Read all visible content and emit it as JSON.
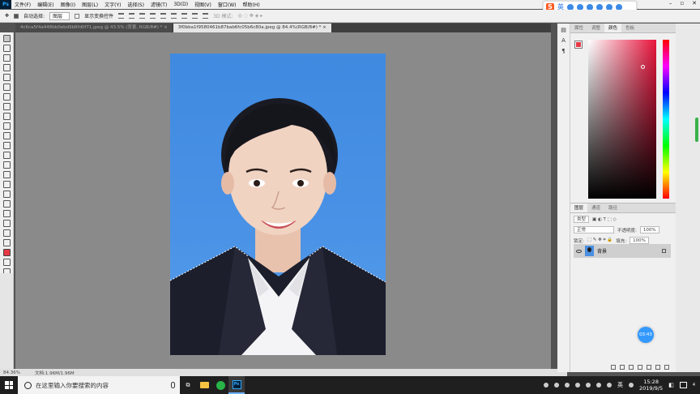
{
  "app": {
    "logo": "Ps"
  },
  "menu": [
    "文件(F)",
    "编辑(E)",
    "图像(I)",
    "图层(L)",
    "文字(Y)",
    "选择(S)",
    "滤镜(T)",
    "3D(D)",
    "视图(V)",
    "窗口(W)",
    "帮助(H)"
  ],
  "options": {
    "auto_select_label": "自动选择:",
    "auto_select_value": "图层",
    "show_transform_label": "显示变换控件",
    "mode_3d": "3D 模式:"
  },
  "ime": {
    "logo": "S",
    "lang": "英"
  },
  "tabs": [
    {
      "label": "4c6ca5f4a448bb0ebd9b8fd0f71.jpeg @ 43.5% (背景, RGB/8#) *",
      "close": "×"
    },
    {
      "label": "3f0bba1f9580461b87bab6fc05b6c80a.jpeg @ 84.4%(RGB/8#) *",
      "close": "×"
    }
  ],
  "status": {
    "zoom": "84.36%",
    "doc": "文档:1.96M/1.96M"
  },
  "panels": {
    "tabs": [
      "属性",
      "调整",
      "颜色",
      "色板"
    ],
    "active_tab": "颜色",
    "fg_color": "#e63946",
    "bg_color": "#ffffff"
  },
  "layers_panel": {
    "tabs": [
      "图层",
      "通道",
      "路径"
    ],
    "filter_placeholder": "类型",
    "blend_mode": "正常",
    "opacity_label": "不透明度:",
    "opacity_value": "100%",
    "lock_label": "锁定:",
    "fill_label": "填充:",
    "fill_value": "100%",
    "layer_name": "背景"
  },
  "timer": "03:43",
  "taskbar": {
    "search_placeholder": "在这里输入你要搜索的内容",
    "lang": "英",
    "time": "15:28",
    "date": "2019/9/5",
    "notif_count": "4"
  }
}
